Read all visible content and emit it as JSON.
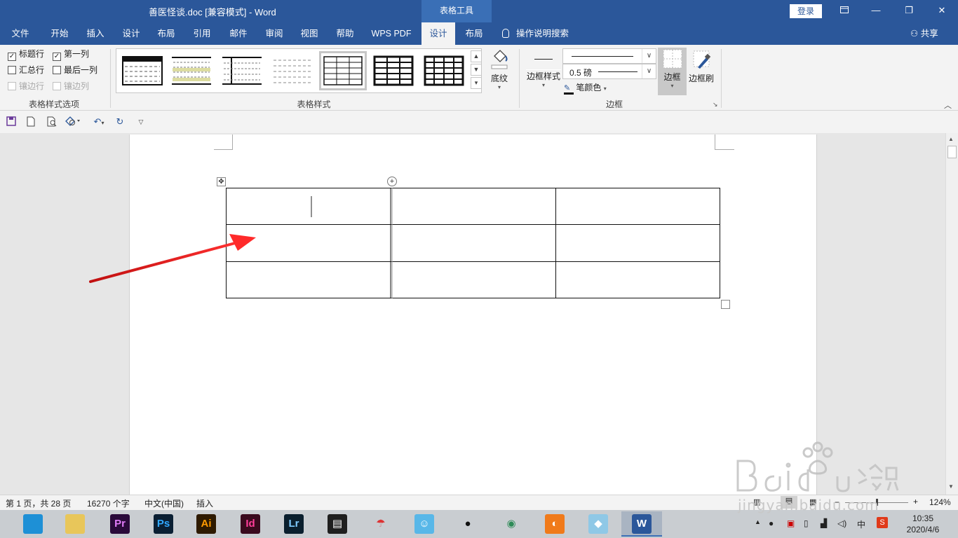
{
  "titlebar": {
    "doc_title": "善医怪谈.doc [兼容模式]  -  Word",
    "context_tool": "表格工具",
    "login": "登录",
    "ribbon_display_icon": "ribbon-display-icon",
    "minimize": "—",
    "restore": "❐",
    "close": "✕"
  },
  "tabs": [
    "文件",
    "开始",
    "插入",
    "设计",
    "布局",
    "引用",
    "邮件",
    "审阅",
    "视图",
    "帮助",
    "WPS PDF",
    "设计",
    "布局"
  ],
  "active_tab_index": 11,
  "tellme": "操作说明搜索",
  "share": "共享",
  "ribbon": {
    "style_options": {
      "header_row": "标题行",
      "first_column": "第一列",
      "total_row": "汇总行",
      "last_column": "最后一列",
      "banded_rows": "镶边行",
      "banded_columns": "镶边列",
      "header_row_checked": true,
      "first_column_checked": true,
      "total_row_checked": false,
      "last_column_checked": false,
      "group_label": "表格样式选项"
    },
    "table_styles": {
      "group_label": "表格样式",
      "shading": "底纹",
      "selected_index": 4
    },
    "borders": {
      "border_styles": "边框样式",
      "line_weight": "0.5 磅",
      "pen_color": "笔颜色",
      "borders_button": "边框",
      "border_painter": "边框刷",
      "group_label": "边框"
    }
  },
  "qat_icons": [
    "save-icon",
    "new-doc-icon",
    "print-preview-icon",
    "shapes-icon",
    "undo-icon",
    "redo-icon",
    "customize-qat-icon"
  ],
  "document": {
    "table": {
      "rows": 3,
      "columns": 3,
      "cells": [
        [
          "",
          "",
          ""
        ],
        [
          "",
          "",
          ""
        ],
        [
          "",
          "",
          ""
        ]
      ]
    }
  },
  "status": {
    "page": "第 1 页，共 28 页",
    "words": "16270 个字",
    "language": "中文(中国)",
    "mode": "插入",
    "zoom": "124%"
  },
  "taskbar": {
    "apps": [
      {
        "name": "browser-icon",
        "label": "",
        "bg": "#1e90d6",
        "fg": "#fff"
      },
      {
        "name": "file-explorer-icon",
        "label": "",
        "bg": "#e8c65a",
        "fg": "#fff"
      },
      {
        "name": "premiere-icon",
        "label": "Pr",
        "bg": "#2a0a3a",
        "fg": "#e07bf7"
      },
      {
        "name": "photoshop-icon",
        "label": "Ps",
        "bg": "#0a1f33",
        "fg": "#31a8ff"
      },
      {
        "name": "illustrator-icon",
        "label": "Ai",
        "bg": "#2e1a00",
        "fg": "#ff9a00"
      },
      {
        "name": "indesign-icon",
        "label": "Id",
        "bg": "#3a0a1e",
        "fg": "#ff3d9a"
      },
      {
        "name": "lightroom-icon",
        "label": "Lr",
        "bg": "#0a1f2e",
        "fg": "#7fcbff"
      },
      {
        "name": "video-editor-icon",
        "label": "▤",
        "bg": "#1f1f1f",
        "fg": "#fff"
      },
      {
        "name": "umbrella-app-icon",
        "label": "☂",
        "bg": "#c9cdd1",
        "fg": "#d33"
      },
      {
        "name": "chat-bot-icon",
        "label": "☺",
        "bg": "#58b7e8",
        "fg": "#fff"
      },
      {
        "name": "qq-icon",
        "label": "●",
        "bg": "#c9cdd1",
        "fg": "#111"
      },
      {
        "name": "chrome-icon",
        "label": "◉",
        "bg": "#c9cdd1",
        "fg": "#2e8b57"
      },
      {
        "name": "orange-app-icon",
        "label": "◐",
        "bg": "#f07a1a",
        "fg": "#fff"
      },
      {
        "name": "notes-app-icon",
        "label": "◆",
        "bg": "#8fc8e6",
        "fg": "#fff"
      },
      {
        "name": "word-icon",
        "label": "W",
        "bg": "#2b579a",
        "fg": "#fff"
      }
    ],
    "active_index": 14,
    "ime": "中",
    "time": "10:35",
    "date": "2020/4/6"
  },
  "colors": {
    "accent": "#2b579a",
    "arrow": "#e02020"
  }
}
